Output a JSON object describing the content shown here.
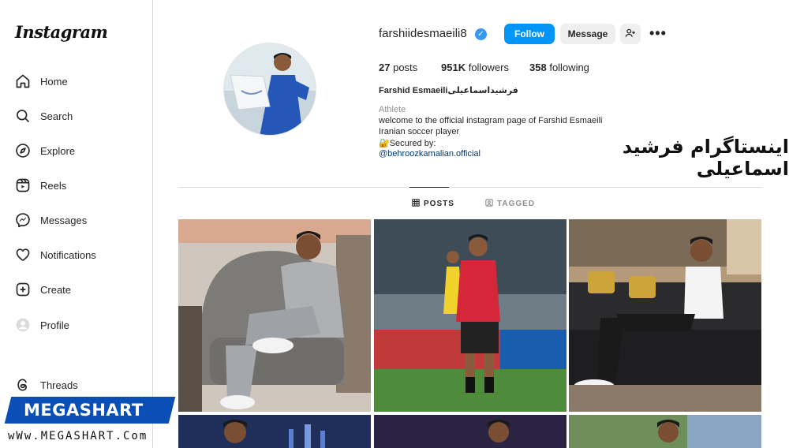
{
  "sidebar": {
    "logo": "Instagram",
    "items": [
      {
        "label": "Home",
        "icon": "home-icon"
      },
      {
        "label": "Search",
        "icon": "search-icon"
      },
      {
        "label": "Explore",
        "icon": "compass-icon"
      },
      {
        "label": "Reels",
        "icon": "reels-icon"
      },
      {
        "label": "Messages",
        "icon": "messenger-icon"
      },
      {
        "label": "Notifications",
        "icon": "heart-icon"
      },
      {
        "label": "Create",
        "icon": "plus-square-icon"
      },
      {
        "label": "Profile",
        "icon": "avatar-icon"
      }
    ],
    "threads": {
      "label": "Threads",
      "icon": "threads-icon"
    }
  },
  "watermark": {
    "brand": "MEGASHART",
    "url": "wWw.MEGASHART.Com"
  },
  "profile": {
    "username": "farshiidesmaeili8",
    "verified_icon": "verified-badge-icon",
    "follow_label": "Follow",
    "message_label": "Message",
    "suggest_icon": "add-person-icon",
    "more_icon": "more-options-icon",
    "posts_count": "27",
    "posts_label": "posts",
    "followers_count": "951K",
    "followers_label": "followers",
    "following_count": "358",
    "following_label": "following",
    "full_name": "Farshid Esmaeiliفرشیداسماعیلی",
    "category": "Athlete",
    "bio_lines": [
      "welcome to the official instagram page of Farshid Esmaeili",
      "Iranian soccer player",
      "🔐Secured by:"
    ],
    "bio_link": "@behroozkamalian.official"
  },
  "overlay_title": "اینستاگرام فرشید اسماعیلی",
  "tabs": [
    {
      "label": "POSTS",
      "icon": "grid-icon",
      "active": true
    },
    {
      "label": "TAGGED",
      "icon": "tagged-icon",
      "active": false
    }
  ],
  "colors": {
    "accent": "#0095f6",
    "verified": "#3897f0",
    "link": "#00376b",
    "watermark": "#0a4fb5"
  }
}
